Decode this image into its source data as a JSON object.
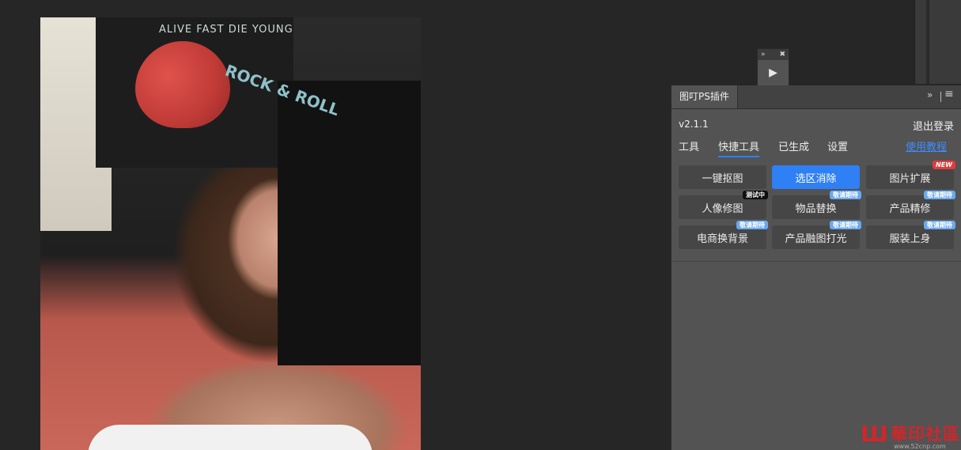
{
  "canvas": {
    "photo_caption": "",
    "poster_text": "ALIVE FAST DIE YOUNG",
    "poster_text_2": "ROCK & ROLL"
  },
  "mini_panel": {
    "expand_icon": "»",
    "close_icon": "✖",
    "play_icon": "▶"
  },
  "plugin": {
    "tab_title": "图叮PS插件",
    "collapse_icon": "»",
    "menu_icon": "≡",
    "version": "v2.1.1",
    "logout": "退出登录",
    "nav": [
      "工具",
      "快捷工具",
      "已生成",
      "设置"
    ],
    "active_nav": "快捷工具",
    "tutorial_link": "使用教程",
    "accent": "#2f7ff5",
    "buttons": [
      {
        "label": "一键抠图",
        "badge": ""
      },
      {
        "label": "选区消除",
        "badge": "",
        "active": true
      },
      {
        "label": "图片扩展",
        "badge": "NEW"
      },
      {
        "label": "人像修图",
        "badge": "测试中"
      },
      {
        "label": "物品替换",
        "badge": "敬请期待"
      },
      {
        "label": "产品精修",
        "badge": "敬请期待"
      },
      {
        "label": "电商换背景",
        "badge": "敬请期待"
      },
      {
        "label": "产品融图打光",
        "badge": "敬请期待"
      },
      {
        "label": "服装上身",
        "badge": "敬请期待"
      }
    ]
  },
  "watermark": {
    "logo": "Ш",
    "text": "華印社區",
    "url": "www.52cnp.com"
  }
}
